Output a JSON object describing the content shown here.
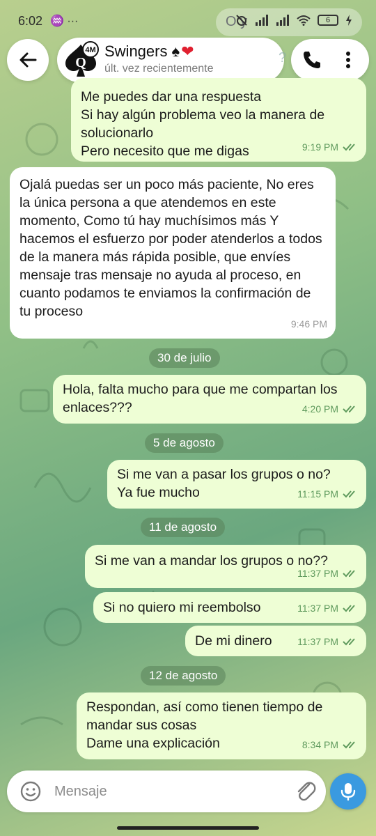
{
  "status_bar": {
    "time": "6:02",
    "notif_icons": "♒ ···",
    "peek_text": "O y",
    "battery": "6"
  },
  "header": {
    "title": "Swingers",
    "title_suits": "♠❤",
    "subtitle": "últ. vez recientemente",
    "avatar_badge": "4M",
    "avatar_letter": "Q",
    "behind_text": "?"
  },
  "messages": [
    {
      "dir": "out",
      "text": "Me puedes dar una respuesta\nSi hay algún problema veo la manera de solucionarlo\nPero necesito que me digas",
      "time": "9:19 PM",
      "read": true
    },
    {
      "dir": "in",
      "text": "Ojalá puedas ser un poco más paciente, No eres la única persona a que atendemos en este momento, Como tú hay muchísimos más Y hacemos el esfuerzo por poder atenderlos a todos de la manera más rápida posible, que envíes mensaje tras mensaje no ayuda al proceso, en cuanto podamos te enviamos la confirmación de tu proceso",
      "time": "9:46 PM"
    },
    {
      "dir": "out",
      "text": "Hola, falta mucho para que me compartan los enlaces???",
      "time": "4:20 PM",
      "read": true
    },
    {
      "dir": "out",
      "text": "Si me van a pasar los grupos o no?\nYa fue mucho",
      "time": "11:15 PM",
      "read": true
    },
    {
      "dir": "out",
      "text": "Si me van a mandar los grupos o no??",
      "time": "11:37 PM",
      "read": true
    },
    {
      "dir": "out",
      "text": "Si no quiero mi reembolso",
      "time": "11:37 PM",
      "read": true
    },
    {
      "dir": "out",
      "text": "De mi dinero",
      "time": "11:37 PM",
      "read": true
    },
    {
      "dir": "out",
      "text": "Respondan, así como tienen tiempo de mandar sus cosas\nDame una explicación",
      "time": "8:34 PM",
      "read": true
    }
  ],
  "dates": [
    "30 de julio",
    "5 de agosto",
    "11 de agosto",
    "12 de agosto"
  ],
  "input": {
    "placeholder": "Mensaje"
  },
  "colors": {
    "outgoing_bubble": "#eefed5",
    "incoming_bubble": "#ffffff",
    "accent_blue": "#3a9ae0",
    "read_ticks": "#5f9a5d"
  }
}
